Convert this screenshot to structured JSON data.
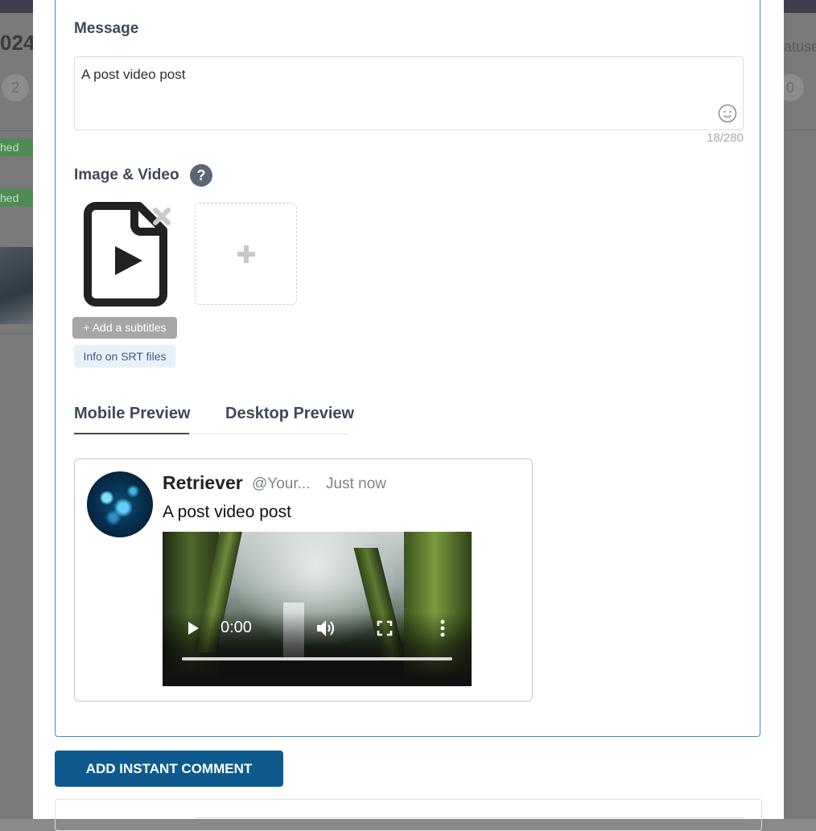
{
  "background": {
    "left_heading": "024",
    "left_counter": "2",
    "status_badges": [
      "hed",
      "hed"
    ],
    "right_heading": "atuse",
    "right_counter": "0"
  },
  "composer": {
    "message_label": "Message",
    "message_text": "A post video post",
    "char_counter": "18/280",
    "media_label": "Image & Video",
    "help_icon": "?",
    "add_subtitles_label": "+ Add a subtitles",
    "srt_info_label": "Info on SRT files",
    "icons": {
      "emoji": "emoji-smile-icon",
      "video_file": "video-file-icon",
      "remove": "remove-x-icon",
      "add": "plus-icon"
    }
  },
  "preview_tabs": [
    {
      "label": "Mobile Preview",
      "active": true
    },
    {
      "label": "Desktop Preview",
      "active": false
    }
  ],
  "preview": {
    "name": "Retriever",
    "handle": "@Your...",
    "time": "Just now",
    "text": "A post video post",
    "video": {
      "current_time": "0:00",
      "progress": 0,
      "controls": [
        "play-icon",
        "volume-icon",
        "fullscreen-icon",
        "more-vertical-icon"
      ]
    }
  },
  "actions": {
    "add_comment_label": "ADD INSTANT COMMENT"
  },
  "colors": {
    "card_border": "#3a8fc4",
    "primary_button": "#0e5a8f",
    "subtitle_button": "#a6a6a6",
    "srt_link_bg": "#e8f1fa"
  }
}
